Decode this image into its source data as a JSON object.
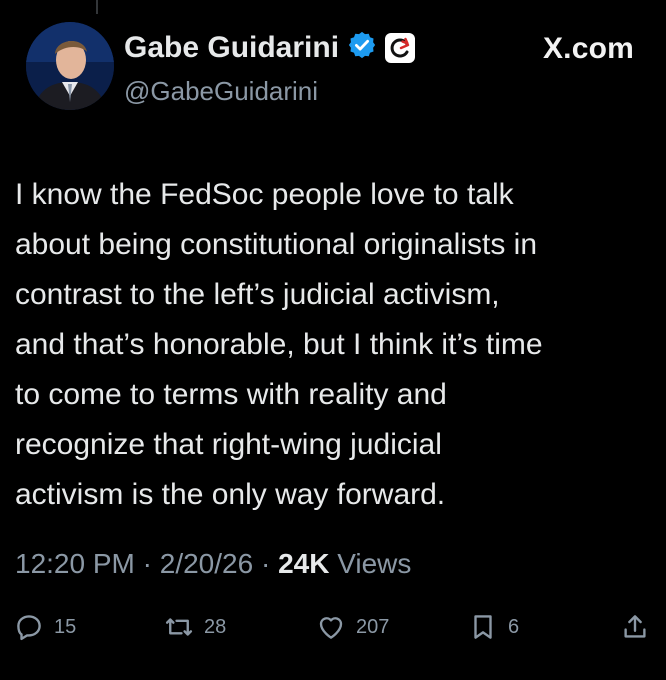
{
  "tweet": {
    "display_name": "Gabe Guidarini",
    "handle": "@GabeGuidarini",
    "site": "X.com",
    "text_lines": [
      "I know the FedSoc people love to talk",
      "about being constitutional originalists in",
      "contrast to the left’s judicial activism,",
      "and that’s honorable, but I think it’s time",
      "to come to terms with reality and",
      "recognize that right-wing judicial",
      "activism is the only way forward."
    ],
    "time": "12:20 PM",
    "date": "2/20/26",
    "sep": " · ",
    "views_count": "24K",
    "views_label": " Views"
  },
  "actions": {
    "replies": "15",
    "reposts": "28",
    "likes": "207",
    "bookmarks": "6"
  },
  "colors": {
    "background": "#000000",
    "text": "#e7e9ea",
    "secondary": "#8b98a5",
    "verified": "#1d9bf0"
  },
  "icons": [
    "verified-badge-icon",
    "affiliation-badge-icon",
    "reply-icon",
    "repost-icon",
    "like-icon",
    "bookmark-icon",
    "share-icon"
  ]
}
